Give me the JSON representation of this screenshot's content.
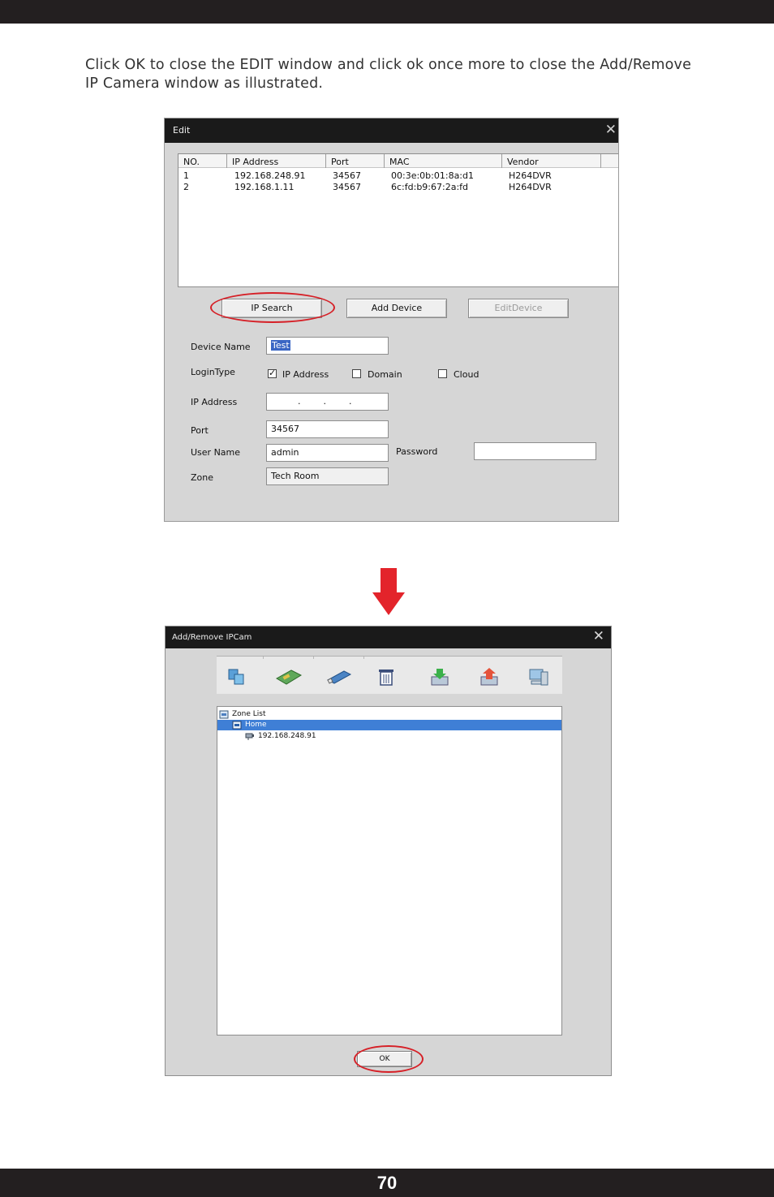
{
  "instructions": "Click OK to close the EDIT window and click ok once more to close the Add/Remove IP Camera window as illustrated.",
  "page_number": "70",
  "edit_window": {
    "title": "Edit",
    "columns": [
      "NO.",
      "IP Address",
      "Port",
      "MAC",
      "Vendor"
    ],
    "rows": [
      {
        "no": "1",
        "ip": "192.168.248.91",
        "port": "34567",
        "mac": "00:3e:0b:01:8a:d1",
        "vendor": "H264DVR"
      },
      {
        "no": "2",
        "ip": "192.168.1.11",
        "port": "34567",
        "mac": "6c:fd:b9:67:2a:fd",
        "vendor": "H264DVR"
      }
    ],
    "buttons": {
      "ip_search": "IP Search",
      "add_device": "Add Device",
      "edit_device": "EditDevice"
    },
    "form": {
      "device_name_label": "Device Name",
      "device_name_value": "Test",
      "login_type_label": "LoginType",
      "login_options": [
        "IP Address",
        "Domain",
        "Cloud"
      ],
      "ip_address_label": "IP Address",
      "ip_address_value": ".        .        .",
      "port_label": "Port",
      "port_value": "34567",
      "user_name_label": "User Name",
      "user_name_value": "admin",
      "password_label": "Password",
      "password_value": "",
      "zone_label": "Zone",
      "zone_value": "Tech Room"
    }
  },
  "add_remove_window": {
    "title": "Add/Remove IPCam",
    "tree": {
      "root": "Zone List",
      "zone": "Home",
      "device": "192.168.248.91"
    },
    "ok_label": "OK"
  },
  "colors": {
    "highlight_ring": "#d62027",
    "arrow": "#e3242b",
    "selection": "#3f7fd6"
  }
}
